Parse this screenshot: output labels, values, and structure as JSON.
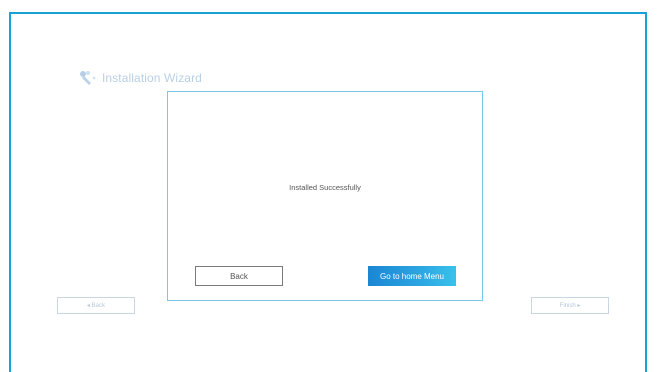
{
  "wizard": {
    "title": "Installation Wizard",
    "logo_icon": "wand-icon",
    "back_label": "◂ Back",
    "finish_label": "Finish ▸"
  },
  "dialog": {
    "message": "Installed Successfully",
    "back_label": "Back",
    "home_label": "Go to home Menu"
  },
  "colors": {
    "frame_border": "#1aa0d8",
    "dialog_border": "#7bc6ea",
    "primary_button": "#1b86d3"
  }
}
